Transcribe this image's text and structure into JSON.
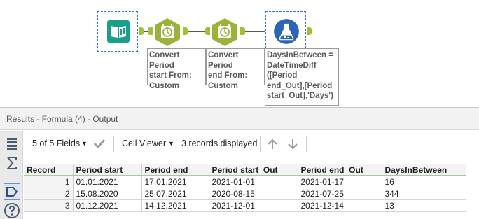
{
  "workflow": {
    "annotations": [
      {
        "text": "Convert Period\nstart From:\nCustom"
      },
      {
        "text": "Convert Period\nend From:\nCustom"
      },
      {
        "text": "DaysInBetween =\nDateTimeDiff\n([Period\nend_Out],[Period\nstart_Out],'Days')"
      }
    ]
  },
  "results": {
    "title": "Results - Formula (4) - Output",
    "fields_label": "5 of 5 Fields",
    "cell_viewer_label": "Cell Viewer",
    "records_label": "3 records displayed",
    "columns": [
      "Record",
      "Period start",
      "Period end",
      "Period start_Out",
      "Period end_Out",
      "DaysInBetween"
    ],
    "rows": [
      [
        "1",
        "01.01.2021",
        "17.01.2021",
        "2021-01-01",
        "2021-01-17",
        "16"
      ],
      [
        "2",
        "15.08.2020",
        "25.07.2021",
        "2020-08-15",
        "2021-07-25",
        "344"
      ],
      [
        "3",
        "01.12.2021",
        "14.12.2021",
        "2021-12-01",
        "2021-12-14",
        "13"
      ]
    ]
  },
  "colors": {
    "input_tool": "#1a9f88",
    "datetime_tool": "#9cb33a",
    "formula_tool": "#2e64b5",
    "anchor": "#9fc138",
    "header_underline": "#9fd08f"
  },
  "icons": {
    "input": "book-icon",
    "datetime": "clock-icon",
    "formula": "flask-icon"
  }
}
